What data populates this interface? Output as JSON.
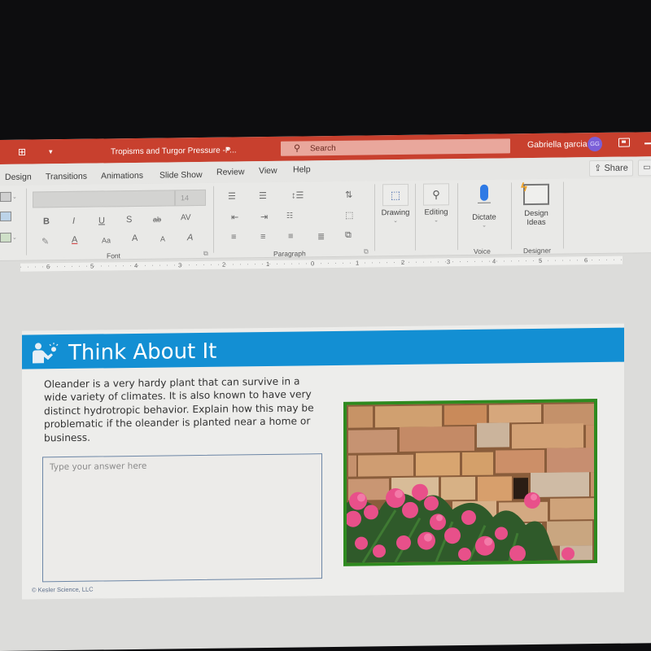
{
  "titlebar": {
    "app_icon": "slideshow-icon",
    "qat_dropdown": "chevron-down-icon",
    "document_title": "Tropisms and Turgor Pressure -P...",
    "title_caret": "▾",
    "search_placeholder": "Search",
    "user_name": "Gabriella garcia",
    "avatar_initials": "GG",
    "avatar_color": "#7b5fd8",
    "accent_color": "#c8402e"
  },
  "tabs": {
    "items": [
      "Design",
      "Transitions",
      "Animations",
      "Slide Show",
      "Review",
      "View",
      "Help"
    ],
    "share_label": "Share"
  },
  "ribbon": {
    "font_group": {
      "font_name": "",
      "font_size": "14",
      "buttons": [
        "B",
        "I",
        "U",
        "S",
        "ab",
        "AV",
        "Aa",
        "A",
        "A",
        "A"
      ],
      "label": "Font"
    },
    "paragraph_group": {
      "label": "Paragraph"
    },
    "drawing_label": "Drawing",
    "editing_label": "Editing",
    "voice_group": {
      "dictate_label": "Dictate",
      "label": "Voice"
    },
    "designer_group": {
      "design_ideas_line1": "Design",
      "design_ideas_line2": "Ideas",
      "label": "Designer"
    }
  },
  "ruler": {
    "labels": [
      "6",
      "5",
      "4",
      "3",
      "2",
      "1",
      "0",
      "1",
      "2",
      "3",
      "4",
      "5",
      "6"
    ]
  },
  "slide": {
    "banner_title": "Think About It",
    "banner_color": "#138fd3",
    "prompt": "Oleander is a very hardy plant that can survive in a wide variety of climates. It is also known to have very distinct hydrotropic behavior. Explain how this may be problematic if the oleander is planted near a home or business.",
    "answer_placeholder": "Type your answer here",
    "answer_value": "",
    "copyright": "© Kesler Science, LLC",
    "image_alt": "Pink oleander flowers growing in front of a sandstone brick wall",
    "image_border_color": "#2e8a1f"
  }
}
